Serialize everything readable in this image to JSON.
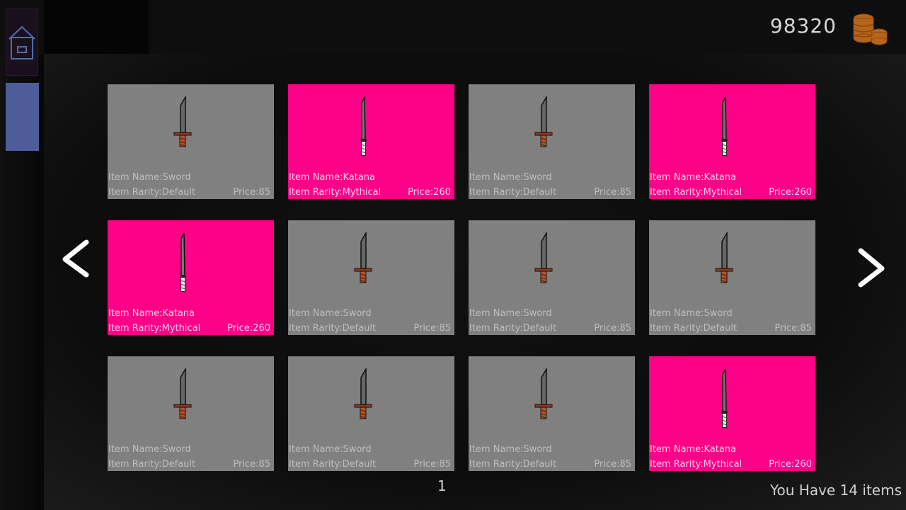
{
  "header": {
    "coins": "98320"
  },
  "icons": {
    "home": "home-icon",
    "coins": "coin-stack-icon",
    "prev": "chevron-left-icon",
    "next": "chevron-right-icon",
    "sword": "sword-icon",
    "katana": "katana-icon"
  },
  "colors": {
    "default_card": "#808080",
    "mythical_card": "#ff0088",
    "side_tab": "#4e5d9a",
    "coin": "#b8651c"
  },
  "items": [
    {
      "name": "Item Name:Sword",
      "rarity": "Item Rarity:Default",
      "price": "Price:85",
      "type": "sword",
      "tier": "default"
    },
    {
      "name": "Item Name:Katana",
      "rarity": "Item Rarity:Mythical",
      "price": "Price:260",
      "type": "katana",
      "tier": "mythical"
    },
    {
      "name": "Item Name:Sword",
      "rarity": "Item Rarity:Default",
      "price": "Price:85",
      "type": "sword",
      "tier": "default"
    },
    {
      "name": "Item Name:Katana",
      "rarity": "Item Rarity:Mythical",
      "price": "Price:260",
      "type": "katana",
      "tier": "mythical"
    },
    {
      "name": "Item Name:Katana",
      "rarity": "Item Rarity:Mythical",
      "price": "Price:260",
      "type": "katana",
      "tier": "mythical"
    },
    {
      "name": "Item Name:Sword",
      "rarity": "Item Rarity:Default",
      "price": "Price:85",
      "type": "sword",
      "tier": "default"
    },
    {
      "name": "Item Name:Sword",
      "rarity": "Item Rarity:Default",
      "price": "Price:85",
      "type": "sword",
      "tier": "default"
    },
    {
      "name": "Item Name:Sword",
      "rarity": "Item Rarity:Default",
      "price": "Price:85",
      "type": "sword",
      "tier": "default"
    },
    {
      "name": "Item Name:Sword",
      "rarity": "Item Rarity:Default",
      "price": "Price:85",
      "type": "sword",
      "tier": "default"
    },
    {
      "name": "Item Name:Sword",
      "rarity": "Item Rarity:Default",
      "price": "Price:85",
      "type": "sword",
      "tier": "default"
    },
    {
      "name": "Item Name:Sword",
      "rarity": "Item Rarity:Default",
      "price": "Price:85",
      "type": "sword",
      "tier": "default"
    },
    {
      "name": "Item Name:Katana",
      "rarity": "Item Rarity:Mythical",
      "price": "Price:260",
      "type": "katana",
      "tier": "mythical"
    }
  ],
  "footer": {
    "page": "1",
    "items_count": "You Have 14 items"
  }
}
